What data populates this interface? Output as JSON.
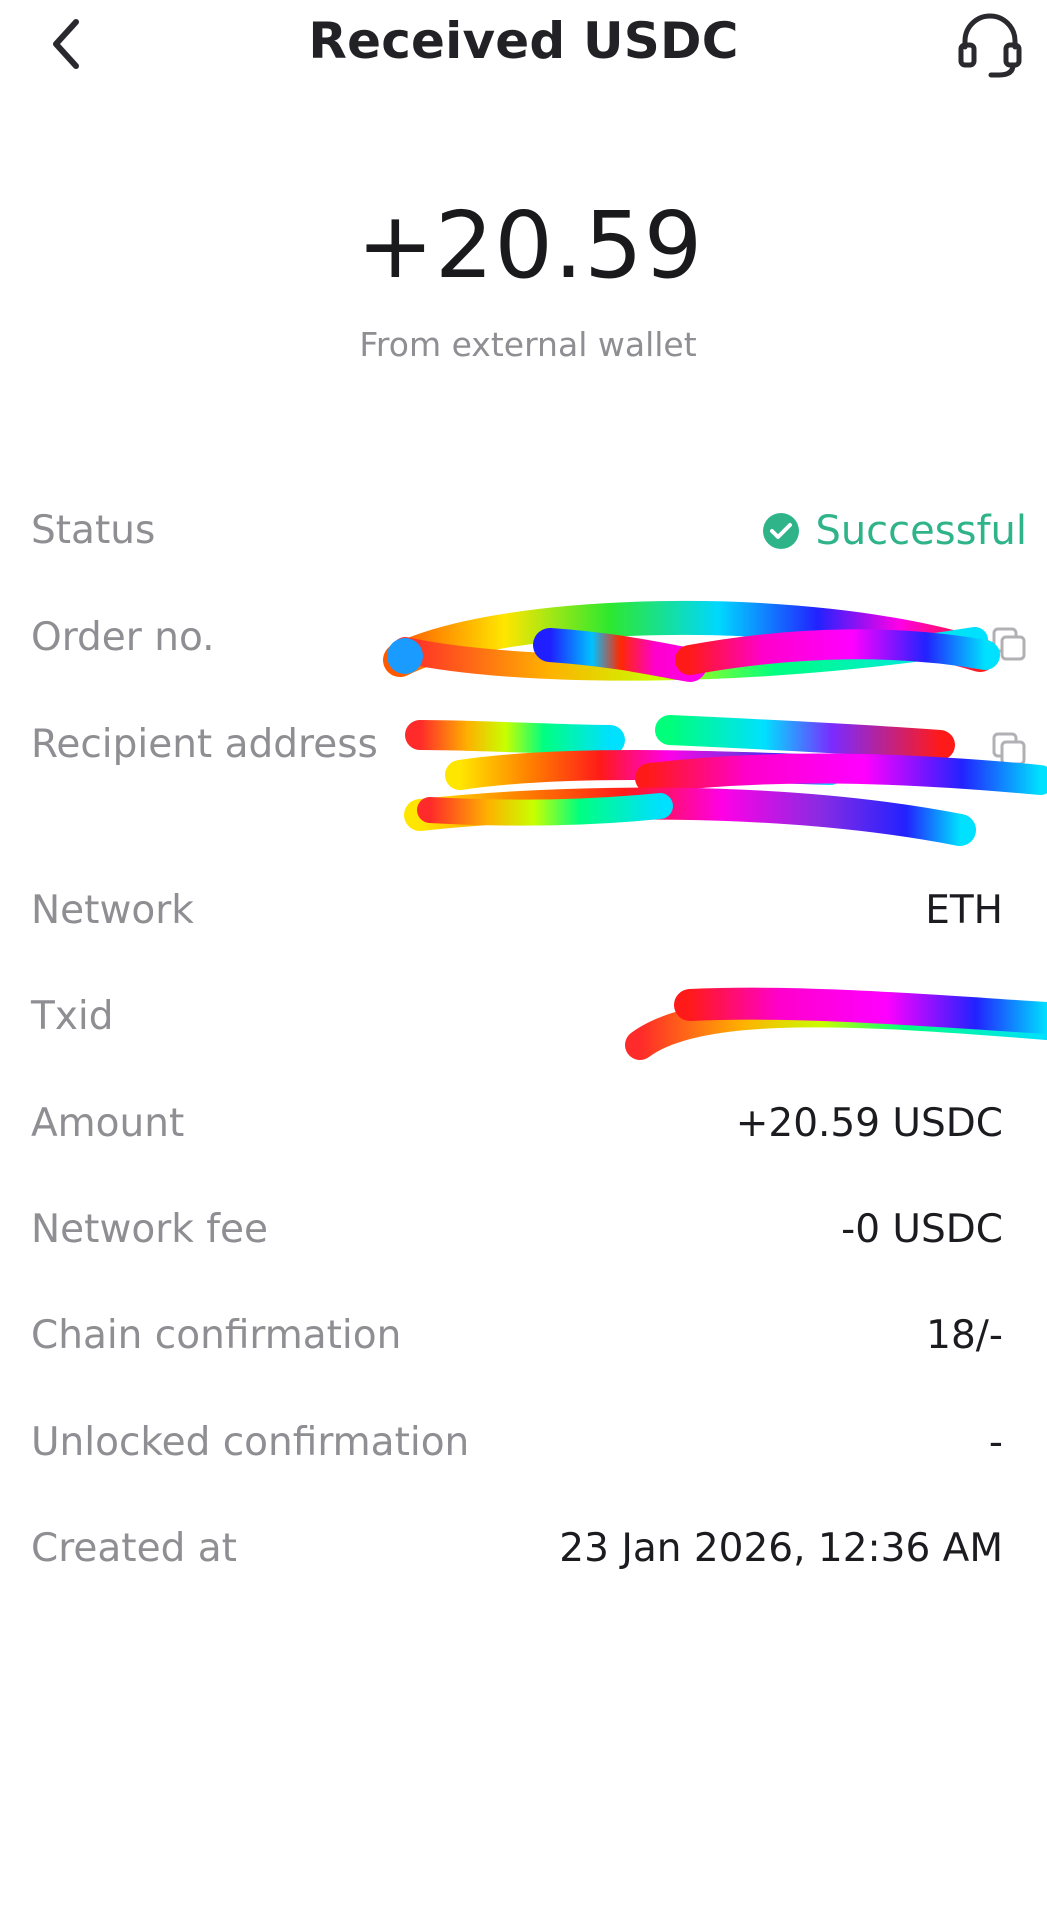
{
  "header": {
    "title": "Received USDC",
    "back_icon": "chevron-left-icon",
    "support_icon": "headset-icon"
  },
  "summary": {
    "amount": "+20.59",
    "source": "From external wallet"
  },
  "details": {
    "status": {
      "label": "Status",
      "value": "Successful",
      "icon": "check-circle-icon",
      "color": "#2fb48a"
    },
    "order_no": {
      "label": "Order no.",
      "value": "",
      "copy_icon": "copy-icon"
    },
    "recipient_address": {
      "label": "Recipient address",
      "value": "",
      "copy_icon": "copy-icon"
    },
    "network": {
      "label": "Network",
      "value": "ETH"
    },
    "txid": {
      "label": "Txid",
      "value": ""
    },
    "amount": {
      "label": "Amount",
      "value": "+20.59 USDC"
    },
    "network_fee": {
      "label": "Network fee",
      "value": "-0 USDC"
    },
    "chain_confirmation": {
      "label": "Chain confirmation",
      "value": "18/-"
    },
    "unlocked_confirmation": {
      "label": "Unlocked confirmation",
      "value": "-"
    },
    "created_at": {
      "label": "Created at",
      "value": "23 Jan 2026, 12:36 AM"
    }
  },
  "colors": {
    "accent_success": "#2fb48a",
    "label_gray": "#8e8e93",
    "text_dark": "#1c1c20"
  }
}
